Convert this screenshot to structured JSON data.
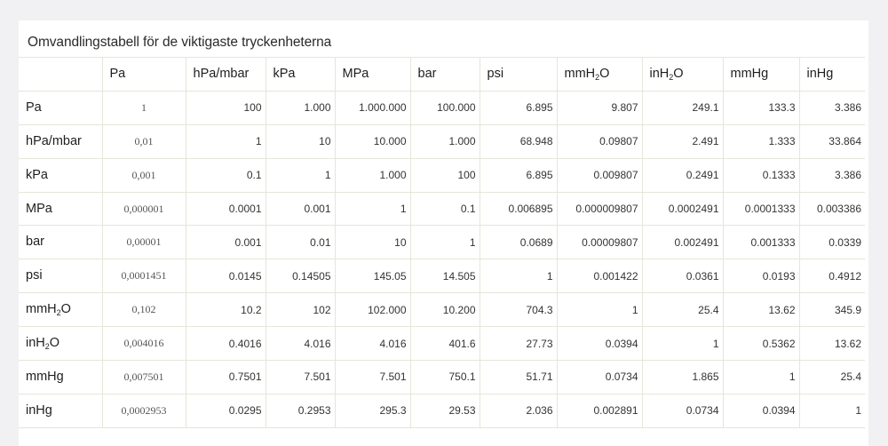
{
  "title": "Omvandlingstabell för de viktigaste tryckenheterna",
  "columns": [
    {
      "pre": "Pa",
      "sub": "",
      "post": ""
    },
    {
      "pre": "hPa/mbar",
      "sub": "",
      "post": ""
    },
    {
      "pre": "kPa",
      "sub": "",
      "post": ""
    },
    {
      "pre": "MPa",
      "sub": "",
      "post": ""
    },
    {
      "pre": "bar",
      "sub": "",
      "post": ""
    },
    {
      "pre": "psi",
      "sub": "",
      "post": ""
    },
    {
      "pre": "mmH",
      "sub": "2",
      "post": "O"
    },
    {
      "pre": "inH",
      "sub": "2",
      "post": "O"
    },
    {
      "pre": "mmHg",
      "sub": "",
      "post": ""
    },
    {
      "pre": "inHg",
      "sub": "",
      "post": ""
    }
  ],
  "rows": [
    {
      "label": {
        "pre": "Pa",
        "sub": "",
        "post": ""
      },
      "values": [
        "1",
        "100",
        "1.000",
        "1.000.000",
        "100.000",
        "6.895",
        "9.807",
        "249.1",
        "133.3",
        "3.386"
      ]
    },
    {
      "label": {
        "pre": "hPa/mbar",
        "sub": "",
        "post": ""
      },
      "values": [
        "0,01",
        "1",
        "10",
        "10.000",
        "1.000",
        "68.948",
        "0.09807",
        "2.491",
        "1.333",
        "33.864"
      ]
    },
    {
      "label": {
        "pre": "kPa",
        "sub": "",
        "post": ""
      },
      "values": [
        "0,001",
        "0.1",
        "1",
        "1.000",
        "100",
        "6.895",
        "0.009807",
        "0.2491",
        "0.1333",
        "3.386"
      ]
    },
    {
      "label": {
        "pre": "MPa",
        "sub": "",
        "post": ""
      },
      "values": [
        "0,000001",
        "0.0001",
        "0.001",
        "1",
        "0.1",
        "0.006895",
        "0.000009807",
        "0.0002491",
        "0.0001333",
        "0.003386"
      ]
    },
    {
      "label": {
        "pre": "bar",
        "sub": "",
        "post": ""
      },
      "values": [
        "0,00001",
        "0.001",
        "0.01",
        "10",
        "1",
        "0.0689",
        "0.00009807",
        "0.002491",
        "0.001333",
        "0.0339"
      ]
    },
    {
      "label": {
        "pre": "psi",
        "sub": "",
        "post": ""
      },
      "values": [
        "0,0001451",
        "0.0145",
        "0.14505",
        "145.05",
        "14.505",
        "1",
        "0.001422",
        "0.0361",
        "0.0193",
        "0.4912"
      ]
    },
    {
      "label": {
        "pre": "mmH",
        "sub": "2",
        "post": "O"
      },
      "values": [
        "0,102",
        "10.2",
        "102",
        "102.000",
        "10.200",
        "704.3",
        "1",
        "25.4",
        "13.62",
        "345.9"
      ]
    },
    {
      "label": {
        "pre": "inH",
        "sub": "2",
        "post": "O"
      },
      "values": [
        "0,004016",
        "0.4016",
        "4.016",
        "4.016",
        "401.6",
        "27.73",
        "0.0394",
        "1",
        "0.5362",
        "13.62"
      ]
    },
    {
      "label": {
        "pre": "mmHg",
        "sub": "",
        "post": ""
      },
      "values": [
        "0,007501",
        "0.7501",
        "7.501",
        "7.501",
        "750.1",
        "51.71",
        "0.0734",
        "1.865",
        "1",
        "25.4"
      ]
    },
    {
      "label": {
        "pre": "inHg",
        "sub": "",
        "post": ""
      },
      "values": [
        "0,0002953",
        "0.0295",
        "0.2953",
        "295.3",
        "29.53",
        "2.036",
        "0.002891",
        "0.0734",
        "0.0394",
        "1"
      ]
    }
  ]
}
